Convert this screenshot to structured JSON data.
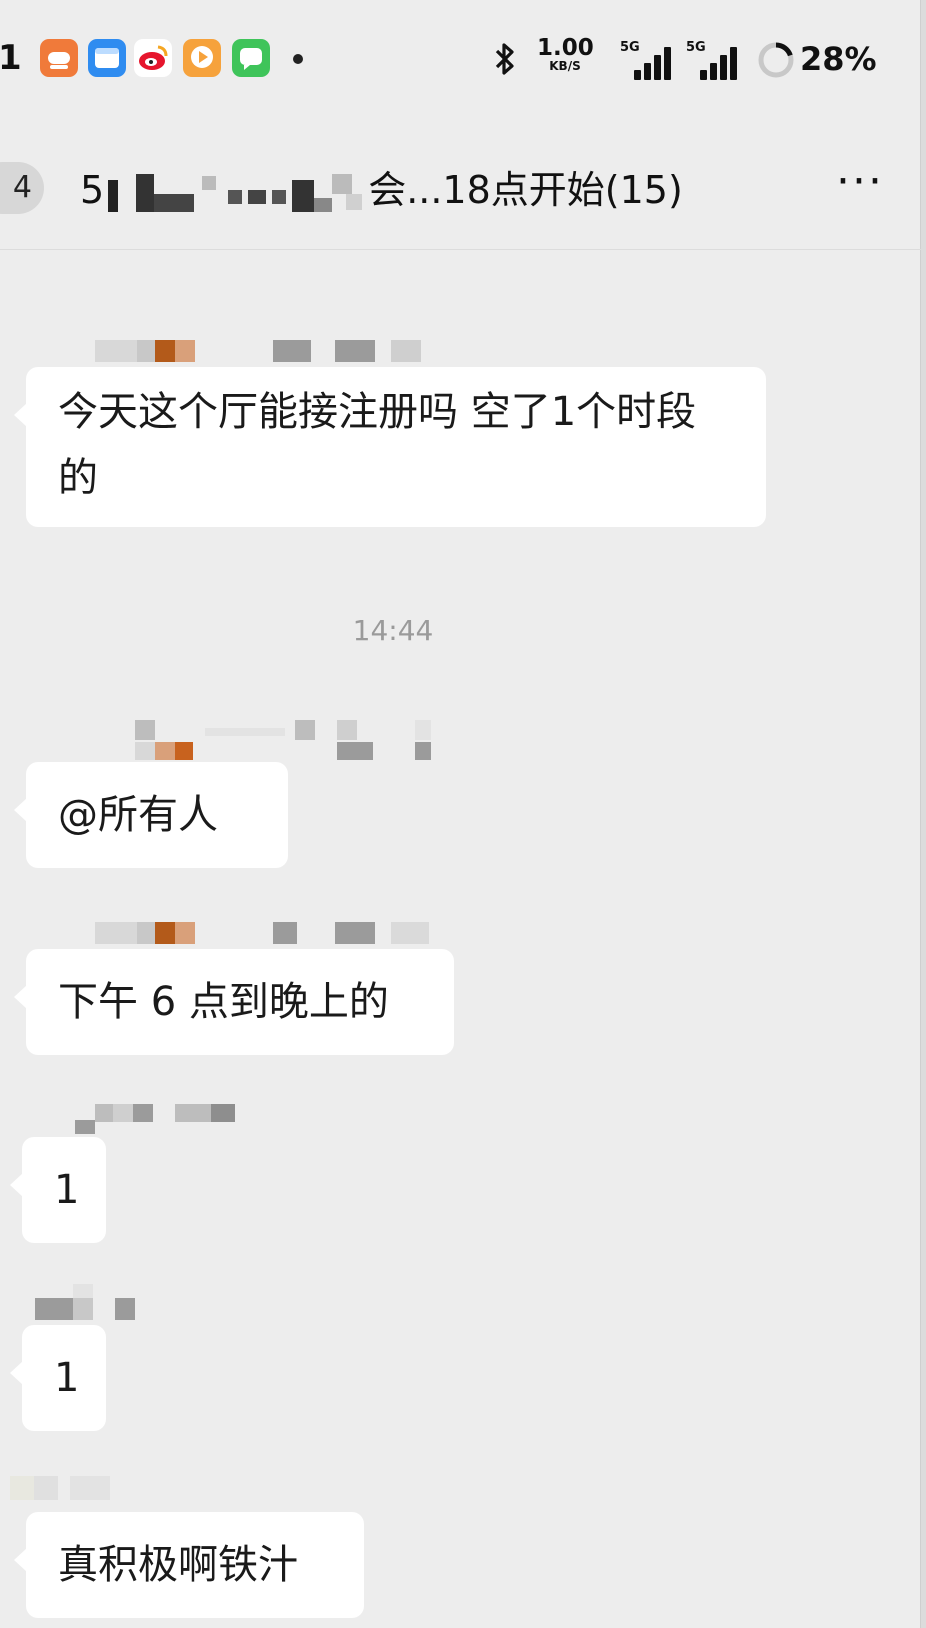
{
  "status_bar": {
    "time": "1",
    "speed_value": "1.00",
    "speed_unit": "KB/S",
    "network_1": "5G",
    "network_2": "5G",
    "battery": "28%"
  },
  "header": {
    "back_count": "4",
    "title_prefix": "5",
    "title_suffix": "会...18点开始(15)",
    "more": "···"
  },
  "messages": [
    {
      "text": "今天这个厅能接注册吗 空了1个时段的"
    },
    {
      "text": "@所有人"
    },
    {
      "text": "下午 6 点到晚上的"
    },
    {
      "text": "1"
    },
    {
      "text": "1"
    },
    {
      "text": "真积极啊铁汁"
    }
  ],
  "timestamp": "14:44",
  "colors": {
    "background": "#ededed",
    "bubble": "#ffffff",
    "text": "#1a1a1a",
    "timestamp": "#9a9a9a"
  },
  "icons": [
    "bluetooth-icon",
    "battery-ring-icon",
    "more-icon"
  ]
}
